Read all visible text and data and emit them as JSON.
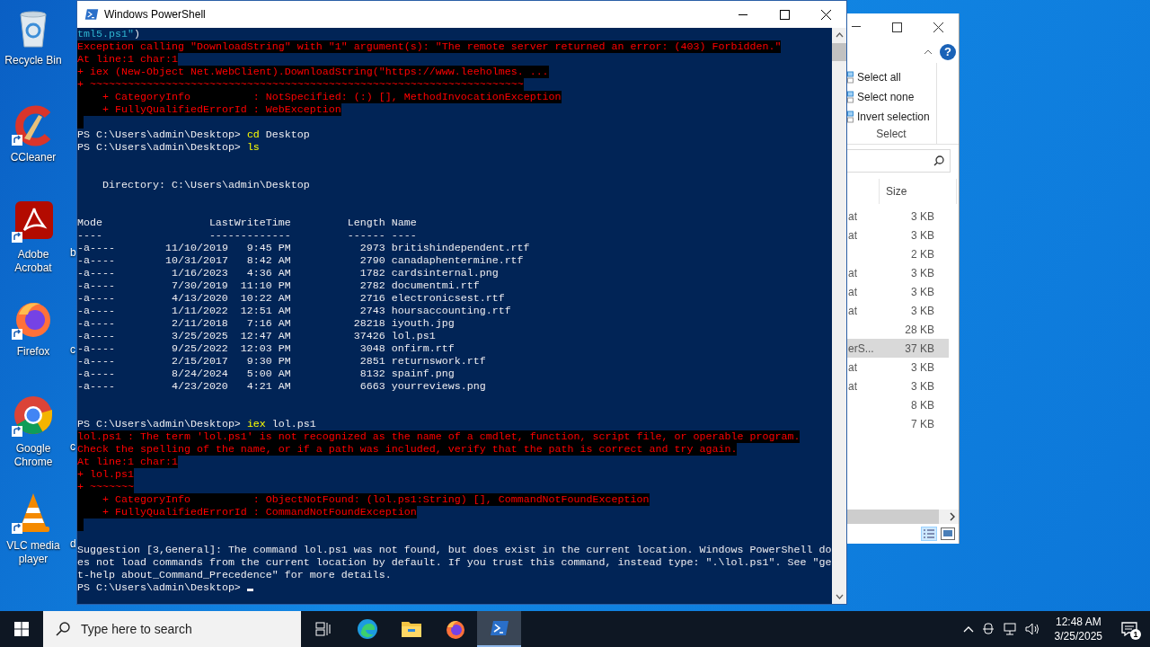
{
  "desktop": {
    "icons": [
      {
        "label": "Recycle Bin",
        "kind": "recycle",
        "shortcut": false
      },
      {
        "label": "CCleaner",
        "kind": "ccleaner",
        "shortcut": true
      },
      {
        "label": "Adobe Acrobat",
        "kind": "acrobat",
        "shortcut": true
      },
      {
        "label": "Firefox",
        "kind": "firefox",
        "shortcut": true
      },
      {
        "label": "Google Chrome",
        "kind": "chrome",
        "shortcut": true
      },
      {
        "label": "VLC media player",
        "kind": "vlc",
        "shortcut": true
      }
    ],
    "hidden_icon_labels": [
      "b",
      "c",
      "c",
      "d"
    ]
  },
  "explorer": {
    "ribbon": {
      "help": "?",
      "items": [
        "Select all",
        "Select none",
        "Invert selection"
      ],
      "group": "Select"
    },
    "columns": [
      "Size"
    ],
    "rows": [
      {
        "name": "at",
        "size": "3 KB",
        "selected": false
      },
      {
        "name": "at",
        "size": "3 KB",
        "selected": false
      },
      {
        "size": "2 KB",
        "selected": false
      },
      {
        "name": "at",
        "size": "3 KB",
        "selected": false
      },
      {
        "name": "at",
        "size": "3 KB",
        "selected": false
      },
      {
        "name": "at",
        "size": "3 KB",
        "selected": false
      },
      {
        "size": "28 KB",
        "selected": false
      },
      {
        "name": "erS...",
        "size": "37 KB",
        "selected": true
      },
      {
        "name": "at",
        "size": "3 KB",
        "selected": false
      },
      {
        "name": "at",
        "size": "3 KB",
        "selected": false
      },
      {
        "size": "8 KB",
        "selected": false
      },
      {
        "size": "7 KB",
        "selected": false
      }
    ]
  },
  "window": {
    "title": "Windows PowerShell"
  },
  "terminal": {
    "lines": [
      {
        "kind": "text",
        "segments": [
          {
            "text": "tml5.ps1\"",
            "kind": "string"
          },
          {
            "text": ")",
            "kind": "plain"
          }
        ]
      },
      {
        "kind": "error",
        "text": "Exception calling \"DownloadString\" with \"1\" argument(s): \"The remote server returned an error: (403) Forbidden.\""
      },
      {
        "kind": "error",
        "text": "At line:1 char:1"
      },
      {
        "kind": "error",
        "text": "+ iex (New-Object Net.WebClient).DownloadString(\"https://www.leeholmes. ..."
      },
      {
        "kind": "error",
        "text": "+ ~~~~~~~~~~~~~~~~~~~~~~~~~~~~~~~~~~~~~~~~~~~~~~~~~~~~~~~~~~~~~~~~~~~~~"
      },
      {
        "kind": "error",
        "text": "    + CategoryInfo          : NotSpecified: (:) [], MethodInvocationException"
      },
      {
        "kind": "error",
        "text": "    + FullyQualifiedErrorId : WebException"
      },
      {
        "kind": "error_end"
      },
      {
        "kind": "text",
        "segments": [
          {
            "text": "PS C:\\Users\\admin\\Desktop> ",
            "kind": "plain"
          },
          {
            "text": "cd",
            "kind": "command"
          },
          {
            "text": " Desktop",
            "kind": "plain"
          }
        ]
      },
      {
        "kind": "text",
        "segments": [
          {
            "text": "PS C:\\Users\\admin\\Desktop> ",
            "kind": "plain"
          },
          {
            "text": "ls",
            "kind": "command"
          }
        ]
      },
      {
        "kind": "blank"
      },
      {
        "kind": "blank"
      },
      {
        "kind": "text",
        "segments": [
          {
            "text": "    Directory: C:\\Users\\admin\\Desktop",
            "kind": "plain"
          }
        ]
      },
      {
        "kind": "blank"
      },
      {
        "kind": "blank"
      },
      {
        "kind": "listing",
        "columns": [
          "Mode",
          "LastWriteTime",
          "Length",
          "Name"
        ],
        "underlines": [
          "----",
          "-------------",
          "------",
          "----"
        ],
        "rows": [
          {
            "mode": "-a----",
            "date": "11/10/2019",
            "time": "9:45 PM",
            "length": "2973",
            "name": "britishindependent.rtf"
          },
          {
            "mode": "-a----",
            "date": "10/31/2017",
            "time": "8:42 AM",
            "length": "2790",
            "name": "canadaphentermine.rtf"
          },
          {
            "mode": "-a----",
            "date": "1/16/2023",
            "time": "4:36 AM",
            "length": "1782",
            "name": "cardsinternal.png"
          },
          {
            "mode": "-a----",
            "date": "7/30/2019",
            "time": "11:10 PM",
            "length": "2782",
            "name": "documentmi.rtf"
          },
          {
            "mode": "-a----",
            "date": "4/13/2020",
            "time": "10:22 AM",
            "length": "2716",
            "name": "electronicsest.rtf"
          },
          {
            "mode": "-a----",
            "date": "1/11/2022",
            "time": "12:51 AM",
            "length": "2743",
            "name": "hoursaccounting.rtf"
          },
          {
            "mode": "-a----",
            "date": "2/11/2018",
            "time": "7:16 AM",
            "length": "28218",
            "name": "iyouth.jpg"
          },
          {
            "mode": "-a----",
            "date": "3/25/2025",
            "time": "12:47 AM",
            "length": "37426",
            "name": "lol.ps1"
          },
          {
            "mode": "-a----",
            "date": "9/25/2022",
            "time": "12:03 PM",
            "length": "3048",
            "name": "onfirm.rtf"
          },
          {
            "mode": "-a----",
            "date": "2/15/2017",
            "time": "9:30 PM",
            "length": "2851",
            "name": "returnswork.rtf"
          },
          {
            "mode": "-a----",
            "date": "8/24/2024",
            "time": "5:00 AM",
            "length": "8132",
            "name": "spainf.png"
          },
          {
            "mode": "-a----",
            "date": "4/23/2020",
            "time": "4:21 AM",
            "length": "6663",
            "name": "yourreviews.png"
          }
        ]
      },
      {
        "kind": "blank"
      },
      {
        "kind": "blank"
      },
      {
        "kind": "text",
        "segments": [
          {
            "text": "PS C:\\Users\\admin\\Desktop> ",
            "kind": "plain"
          },
          {
            "text": "iex",
            "kind": "command"
          },
          {
            "text": " lol.ps1",
            "kind": "plain"
          }
        ]
      },
      {
        "kind": "error",
        "text": "lol.ps1 : The term 'lol.ps1' is not recognized as the name of a cmdlet, function, script file, or operable program."
      },
      {
        "kind": "error",
        "text": "Check the spelling of the name, or if a path was included, verify that the path is correct and try again."
      },
      {
        "kind": "error",
        "text": "At line:1 char:1"
      },
      {
        "kind": "error",
        "text": "+ lol.ps1"
      },
      {
        "kind": "error",
        "text": "+ ~~~~~~~"
      },
      {
        "kind": "error",
        "text": "    + CategoryInfo          : ObjectNotFound: (lol.ps1:String) [], CommandNotFoundException"
      },
      {
        "kind": "error",
        "text": "    + FullyQualifiedErrorId : CommandNotFoundException"
      },
      {
        "kind": "error_end"
      },
      {
        "kind": "blank"
      },
      {
        "kind": "text",
        "segments": [
          {
            "text": "Suggestion [3,General]: The command lol.ps1 was not found, but does exist in the current location. Windows PowerShell do",
            "kind": "plain"
          }
        ]
      },
      {
        "kind": "text",
        "segments": [
          {
            "text": "es not load commands from the current location by default. If you trust this command, instead type: \".\\lol.ps1\". See \"ge",
            "kind": "plain"
          }
        ]
      },
      {
        "kind": "text",
        "segments": [
          {
            "text": "t-help about_Command_Precedence\" for more details.",
            "kind": "plain"
          }
        ]
      },
      {
        "kind": "text",
        "segments": [
          {
            "text": "PS C:\\Users\\admin\\Desktop> ",
            "kind": "plain"
          }
        ],
        "cursor": true
      }
    ]
  },
  "taskbar": {
    "search": {
      "placeholder": "Type here to search"
    },
    "apps": [
      {
        "kind": "taskview",
        "active": false
      },
      {
        "kind": "edge",
        "active": false
      },
      {
        "kind": "explorer",
        "active": false
      },
      {
        "kind": "firefox",
        "active": false
      },
      {
        "kind": "powershell",
        "active": true
      }
    ],
    "clock": {
      "time": "12:48 AM",
      "date": "3/25/2025"
    },
    "notifications": "1"
  }
}
